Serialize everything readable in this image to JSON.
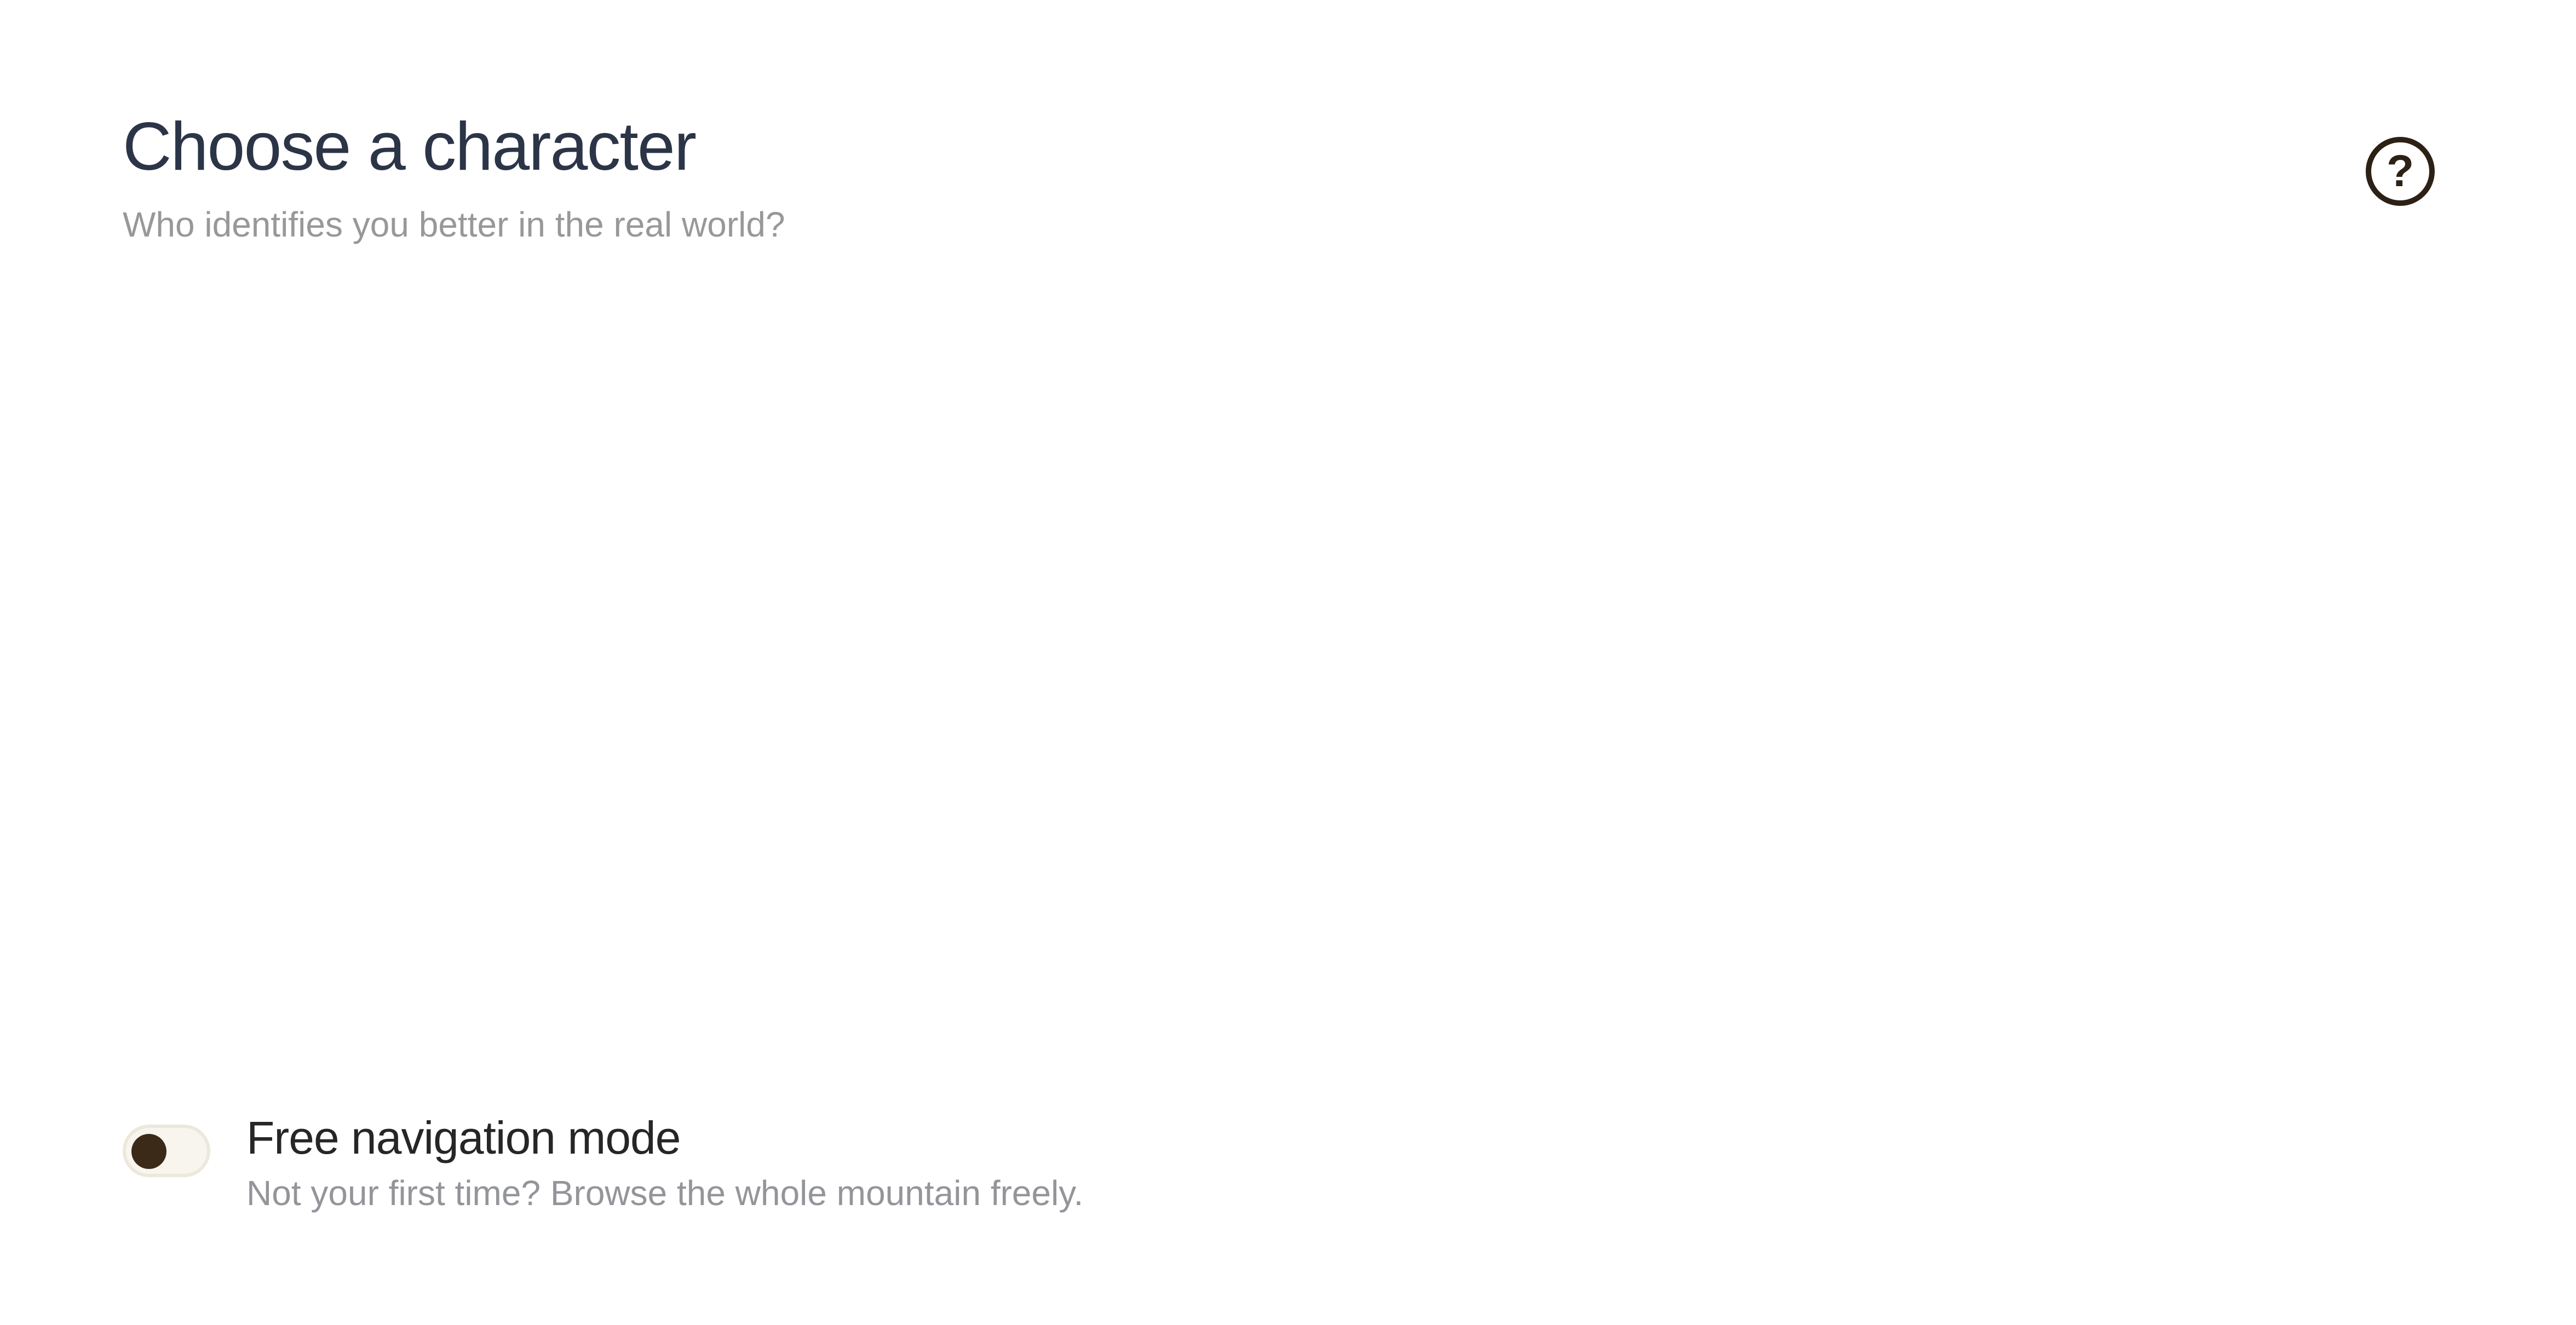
{
  "header": {
    "title": "Choose a character",
    "subtitle": "Who identifies you better in the real world?"
  },
  "help": {
    "icon": "help-circle-icon",
    "glyph": "?"
  },
  "free_navigation": {
    "label": "Free navigation mode",
    "description": "Not your first time? Browse the whole mountain freely.",
    "enabled": false
  },
  "colors": {
    "title": "#2c3547",
    "muted_text": "#97989a",
    "accent_dark": "#3c2a18",
    "toggle_track": "#f7f5ee"
  }
}
